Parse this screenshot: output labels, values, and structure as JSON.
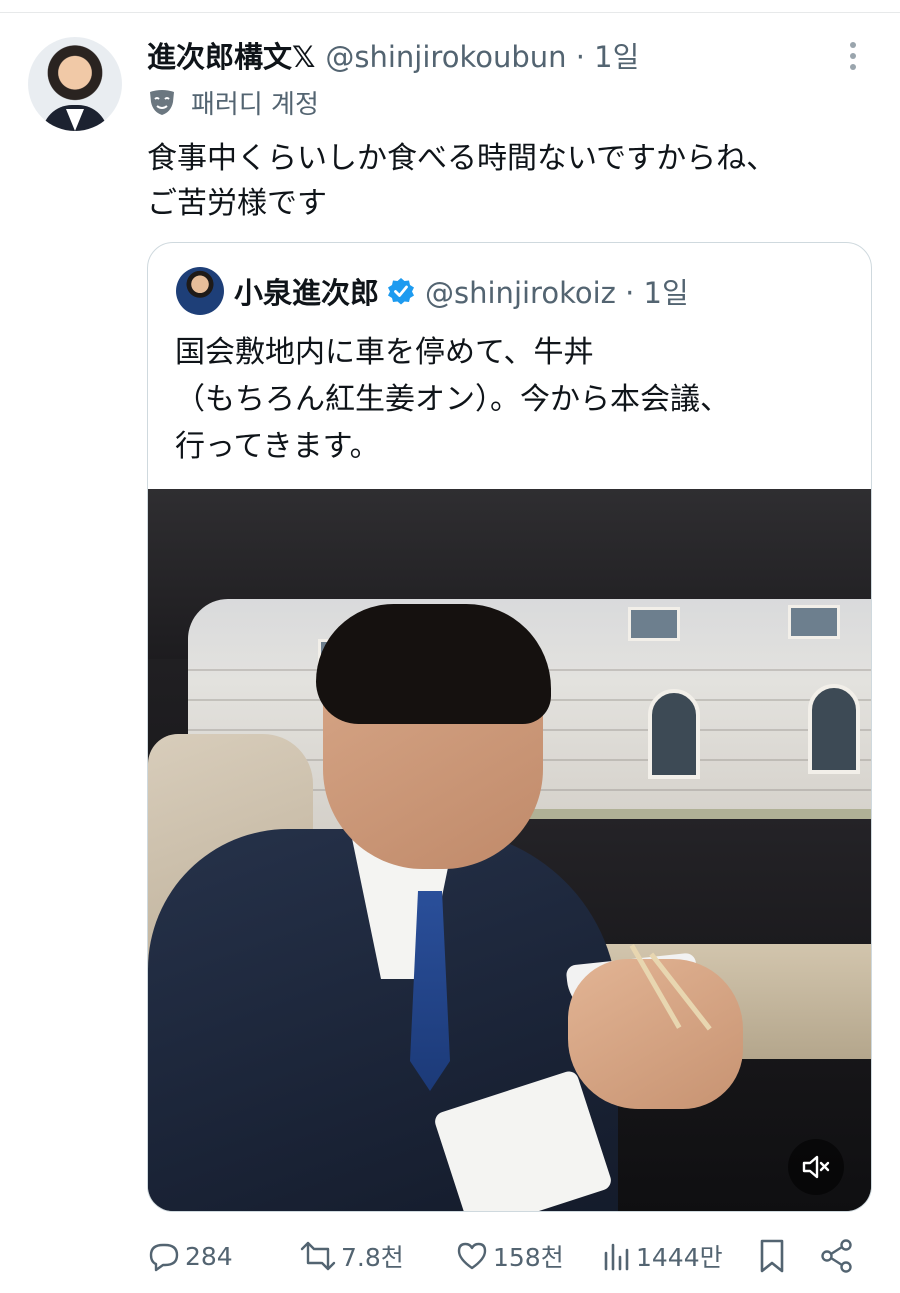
{
  "tweet": {
    "author_name": "進次郎構文𝕏",
    "author_handle": "@shinjirokoubun",
    "timestamp": "1일",
    "label": "패러디 계정",
    "text_lines": [
      "食事中くらいしか食べる時間ないですからね、",
      "ご苦労様です"
    ]
  },
  "quoted": {
    "author_name": "小泉進次郎",
    "author_handle": "@shinjirokoiz",
    "timestamp": "1일",
    "verified": true,
    "text_lines": [
      "国会敷地内に車を停めて、牛丼",
      "（もちろん紅生姜オン）。今から本会議、",
      "行ってきます。"
    ]
  },
  "actions": {
    "replies": "284",
    "reposts": "7.8천",
    "likes": "158천",
    "views": "1444만"
  },
  "icons": [
    "more-icon",
    "parody-mask-icon",
    "verified-badge-icon",
    "mute-icon",
    "reply-icon",
    "repost-icon",
    "like-icon",
    "views-icon",
    "bookmark-icon",
    "share-icon"
  ],
  "colors": {
    "text": "#0f1419",
    "muted": "#536471",
    "border": "#cfd9de",
    "verified": "#1d9bf0"
  }
}
